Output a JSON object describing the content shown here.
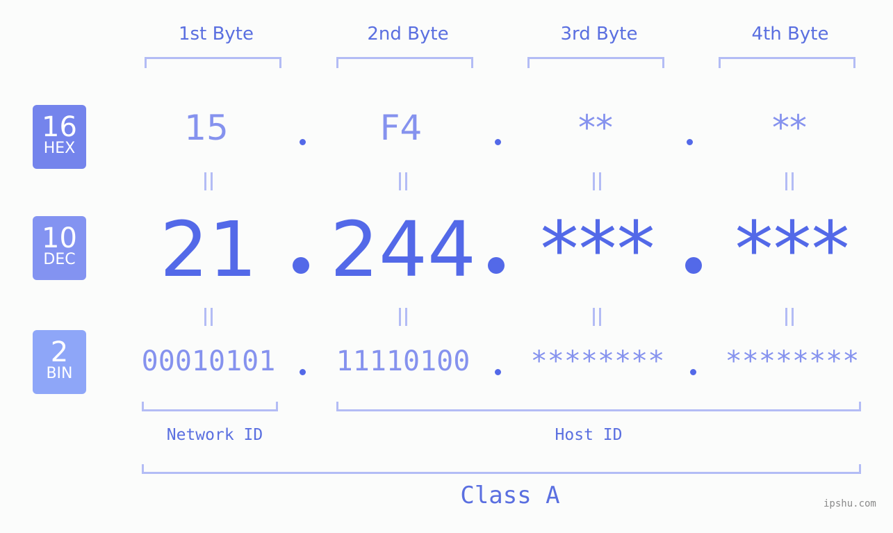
{
  "bytes": {
    "headers": [
      "1st Byte",
      "2nd Byte",
      "3rd Byte",
      "4th Byte"
    ]
  },
  "badges": {
    "hex": {
      "num": "16",
      "label": "HEX",
      "color": "#7484ec"
    },
    "dec": {
      "num": "10",
      "label": "DEC",
      "color": "#8393f1"
    },
    "bin": {
      "num": "2",
      "label": "BIN",
      "color": "#8ea6f8"
    }
  },
  "values": {
    "hex": [
      "15",
      "F4",
      "**",
      "**"
    ],
    "dec": [
      "21",
      "244",
      "***",
      "***"
    ],
    "bin": [
      "00010101",
      "11110100",
      "********",
      "********"
    ]
  },
  "segments": {
    "network_label": "Network ID",
    "host_label": "Host ID",
    "class_label": "Class A"
  },
  "watermark": "ipshu.com",
  "colors": {
    "accent": "#5369e8",
    "light": "#8592ee",
    "bracket": "#b3bcf5"
  }
}
